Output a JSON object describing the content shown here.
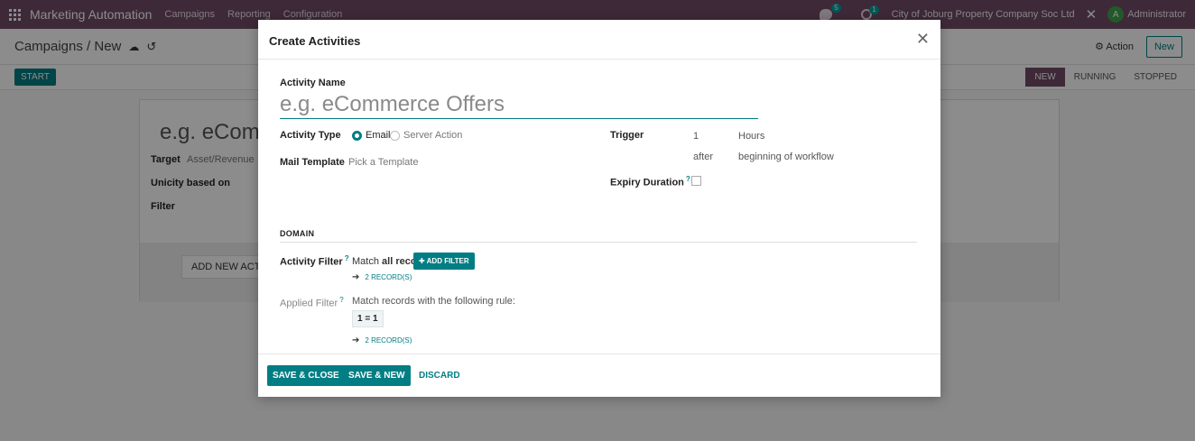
{
  "navbar": {
    "app_name": "Marketing Automation",
    "menu": [
      "Campaigns",
      "Reporting",
      "Configuration"
    ],
    "chat_count": "5",
    "activity_count": "1",
    "company": "City of Joburg Property Company Soc Ltd",
    "avatar_initial": "A",
    "user": "Administrator"
  },
  "control": {
    "breadcrumb": "Campaigns / New",
    "action_label": "Action",
    "new_label": "New"
  },
  "statusbar": {
    "start_label": "START",
    "stages": [
      "NEW",
      "RUNNING",
      "STOPPED"
    ],
    "active_stage": "NEW"
  },
  "background_form": {
    "title_placeholder": "e.g. eCom",
    "target_label": "Target",
    "target_value": "Asset/Revenue",
    "unicity_label": "Unicity based on",
    "filter_label": "Filter",
    "add_activity_label": "ADD NEW ACTIV"
  },
  "modal": {
    "title": "Create Activities",
    "activity_name_label": "Activity Name",
    "activity_name_placeholder": "e.g. eCommerce Offers",
    "activity_type_label": "Activity Type",
    "type_options": [
      "Email",
      "Server Action"
    ],
    "type_selected": "Email",
    "mail_template_label": "Mail Template",
    "mail_template_placeholder": "Pick a Template",
    "trigger_label": "Trigger",
    "trigger_value": "1",
    "trigger_unit": "Hours",
    "trigger_when": "after",
    "trigger_ref": "beginning of workflow",
    "expiry_label": "Expiry Duration",
    "domain_title": "DOMAIN",
    "activity_filter_label": "Activity Filter",
    "match_prefix": "Match",
    "match_bold": "all records",
    "add_filter_label": "ADD FILTER",
    "records_link_1": "2 RECORD(S)",
    "applied_filter_label": "Applied Filter",
    "applied_rule_text": "Match records with the following rule:",
    "rule_chip": "1 = 1",
    "records_link_2": "2 RECORD(S)",
    "footer": {
      "save_close": "SAVE & CLOSE",
      "save_new": "SAVE & NEW",
      "discard": "DISCARD"
    }
  },
  "colors": {
    "navbar": "#714b67",
    "primary": "#017e84"
  }
}
